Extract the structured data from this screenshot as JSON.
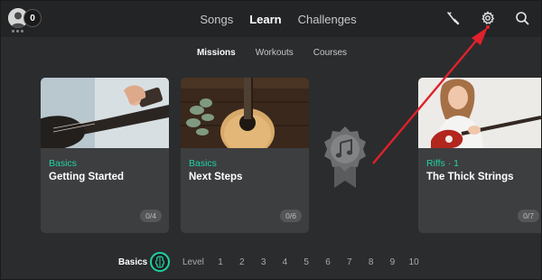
{
  "header": {
    "xp_count": "0",
    "nav": [
      {
        "label": "Songs"
      },
      {
        "label": "Learn"
      },
      {
        "label": "Challenges"
      }
    ]
  },
  "subtabs": [
    {
      "label": "Missions"
    },
    {
      "label": "Workouts"
    },
    {
      "label": "Courses"
    }
  ],
  "cards": [
    {
      "category": "Basics",
      "title": "Getting Started",
      "progress": "0/4"
    },
    {
      "category": "Basics",
      "title": "Next Steps",
      "progress": "0/6"
    },
    {
      "category": "Riffs · 1",
      "title": "The Thick Strings",
      "progress": "0/7"
    }
  ],
  "levelbar": {
    "basics_label": "Basics",
    "level_label": "Level",
    "levels": [
      "1",
      "2",
      "3",
      "4",
      "5",
      "6",
      "7",
      "8",
      "9",
      "10"
    ]
  },
  "colors": {
    "accent": "#1fd2a3",
    "arrow": "#e0212b",
    "background": "#2b2c2e",
    "card": "#3d3e40"
  },
  "icons": [
    "avatar-icon",
    "tuner-icon",
    "gear-icon",
    "search-icon",
    "music-note-icon",
    "guitar-icon"
  ]
}
